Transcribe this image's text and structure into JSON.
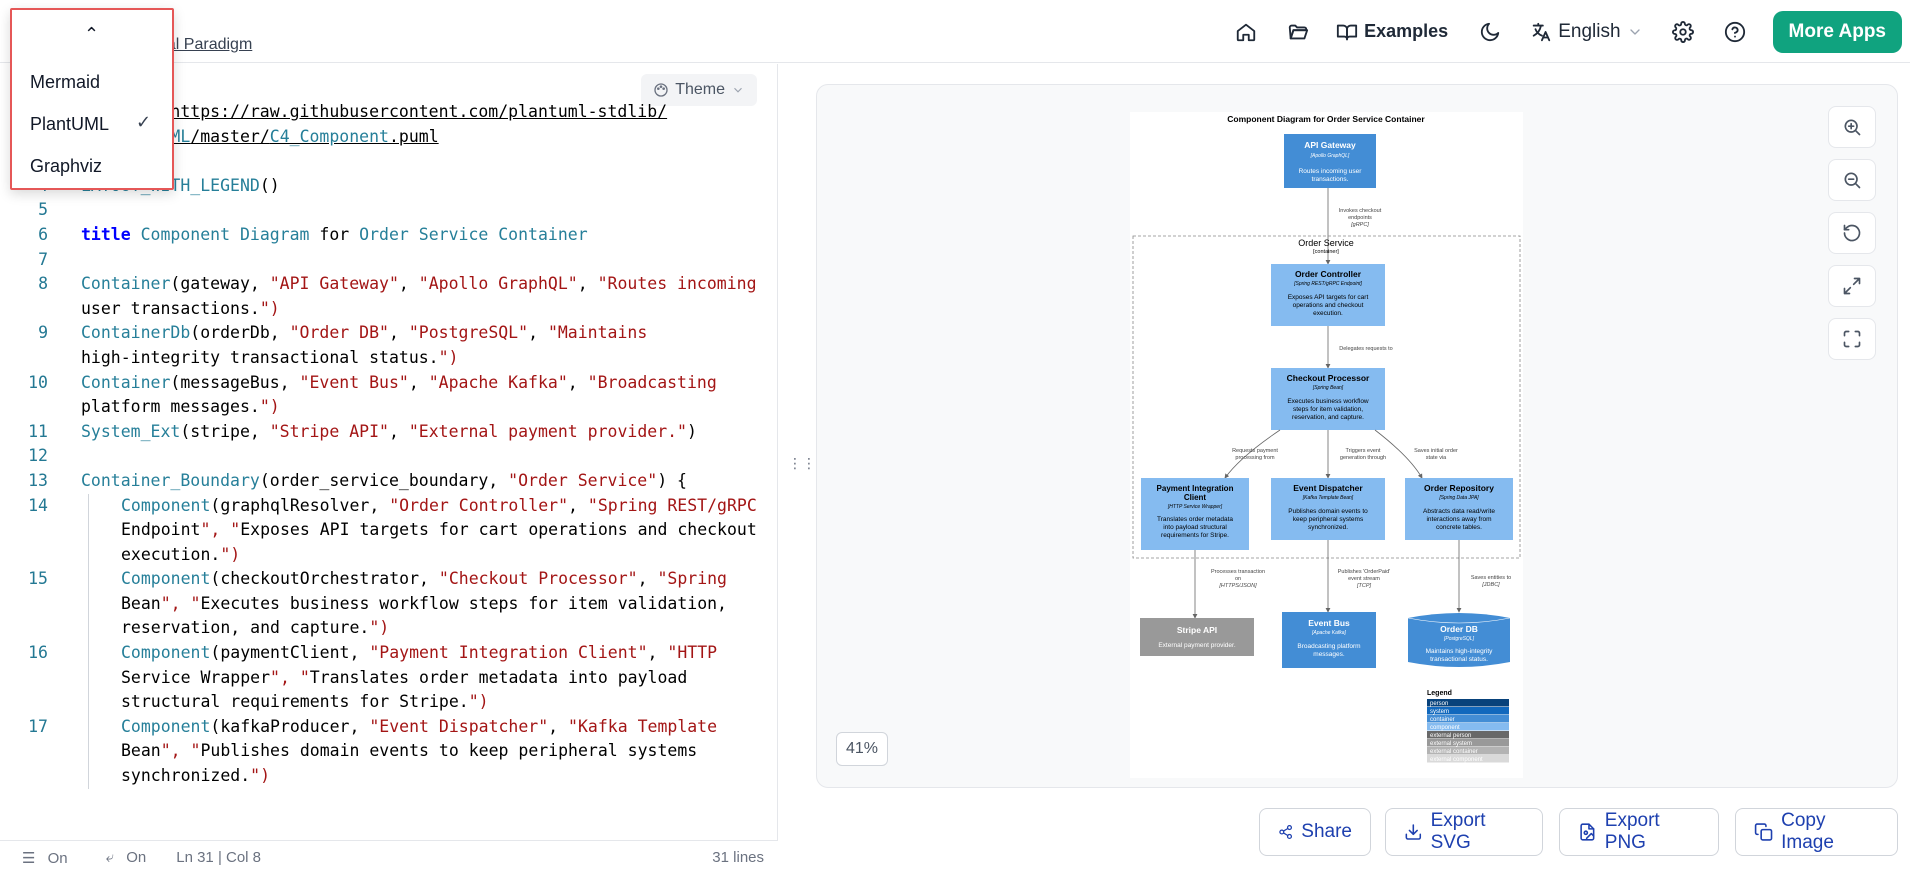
{
  "header": {
    "brand_subtitle": "sual Paradigm",
    "nav": {
      "examples_label": "Examples",
      "language_label": "English",
      "more_apps_label": "More Apps"
    }
  },
  "dropdown": {
    "items": [
      {
        "label": "Mermaid",
        "checked": false
      },
      {
        "label": "PlantUML",
        "checked": true
      },
      {
        "label": "Graphviz",
        "checked": false
      }
    ]
  },
  "editor": {
    "theme_label": "Theme",
    "status": {
      "line_numbers": "On",
      "word_wrap": "On",
      "cursor": "Ln 31 | Col 8",
      "line_count": "31 lines"
    },
    "code_lines": [
      {
        "n": "",
        "text": "!include https://raw.githubusercontent.com/plantuml-stdlib/"
      },
      {
        "n": "",
        "text": "C4-PlantUML/master/C4_Component.puml"
      },
      {
        "n": "3",
        "text": ""
      },
      {
        "n": "4",
        "text": "LAYOUT_WITH_LEGEND()"
      },
      {
        "n": "5",
        "text": ""
      },
      {
        "n": "6",
        "text": "title Component Diagram for Order Service Container"
      },
      {
        "n": "7",
        "text": ""
      },
      {
        "n": "8",
        "text": "Container(gateway, \"API Gateway\", \"Apollo GraphQL\", \"Routes incoming"
      },
      {
        "n": "",
        "text": "user transactions.\")"
      },
      {
        "n": "9",
        "text": "ContainerDb(orderDb, \"Order DB\", \"PostgreSQL\", \"Maintains"
      },
      {
        "n": "",
        "text": "high-integrity transactional status.\")"
      },
      {
        "n": "10",
        "text": "Container(messageBus, \"Event Bus\", \"Apache Kafka\", \"Broadcasting"
      },
      {
        "n": "",
        "text": "platform messages.\")"
      },
      {
        "n": "11",
        "text": "System_Ext(stripe, \"Stripe API\", \"External payment provider.\")"
      },
      {
        "n": "12",
        "text": ""
      },
      {
        "n": "13",
        "text": "Container_Boundary(order_service_boundary, \"Order Service\") {"
      },
      {
        "n": "14",
        "text": "Component(graphqlResolver, \"Order Controller\", \"Spring REST/gRPC"
      },
      {
        "n": "",
        "text": "Endpoint\", \"Exposes API targets for cart operations and checkout"
      },
      {
        "n": "",
        "text": "execution.\")"
      },
      {
        "n": "15",
        "text": "Component(checkoutOrchestrator, \"Checkout Processor\", \"Spring"
      },
      {
        "n": "",
        "text": "Bean\", \"Executes business workflow steps for item validation,"
      },
      {
        "n": "",
        "text": "reservation, and capture.\")"
      },
      {
        "n": "16",
        "text": "Component(paymentClient, \"Payment Integration Client\", \"HTTP"
      },
      {
        "n": "",
        "text": "Service Wrapper\", \"Translates order metadata into payload"
      },
      {
        "n": "",
        "text": "structural requirements for Stripe.\")"
      },
      {
        "n": "17",
        "text": "Component(kafkaProducer, \"Event Dispatcher\", \"Kafka Template"
      },
      {
        "n": "",
        "text": "Bean\", \"Publishes domain events to keep peripheral systems"
      },
      {
        "n": "",
        "text": "synchronized.\")"
      }
    ]
  },
  "preview": {
    "zoom_label": "41%",
    "actions": {
      "share": "Share",
      "export_svg": "Export SVG",
      "export_png": "Export PNG",
      "copy_image": "Copy Image"
    },
    "diagram": {
      "title": "Component Diagram for Order Service Container",
      "gateway": {
        "name": "API Gateway",
        "tech": "[Apollo GraphQL]",
        "desc": "Routes incoming user transactions."
      },
      "boundary_label": "Order Service",
      "boundary_type": "[container]",
      "controller": {
        "name": "Order Controller",
        "tech": "[Spring REST/gRPC Endpoint]",
        "desc": "Exposes API targets for cart operations and checkout execution."
      },
      "processor": {
        "name": "Checkout Processor",
        "tech": "[Spring Bean]",
        "desc": "Executes business workflow steps for item validation, reservation, and capture."
      },
      "payment": {
        "name": "Payment Integration Client",
        "tech": "[HTTP Service Wrapper]",
        "desc": "Translates order metadata into payload structural requirements for Stripe."
      },
      "dispatcher": {
        "name": "Event Dispatcher",
        "tech": "[Kafka Template Bean]",
        "desc": "Publishes domain events to keep peripheral systems synchronized."
      },
      "repository": {
        "name": "Order Repository",
        "tech": "[Spring Data JPA]",
        "desc": "Abstracts data read/write interactions away from concrete tables."
      },
      "stripe": {
        "name": "Stripe API",
        "desc": "External payment provider."
      },
      "bus": {
        "name": "Event Bus",
        "tech": "[Apache Kafka]",
        "desc": "Broadcasting platform messages."
      },
      "db": {
        "name": "Order DB",
        "tech": "[PostgreSQL]",
        "desc": "Maintains high-integrity transactional status."
      },
      "rel_gateway": "Invokes checkout endpoints [gRPC]",
      "rel_controller": "Delegates requests to",
      "rel_payment": "Requests payment processing from",
      "rel_dispatch": "Triggers event generation through",
      "rel_repo": "Saves initial order state via",
      "rel_stripe": "Processes transaction on [HTTPS/JSON]",
      "rel_bus": "Publishes 'OrderPaid' event stream [TCP]",
      "rel_db": "Saves entities to [JDBC]",
      "legend_title": "Legend",
      "legend_items": [
        "person",
        "system",
        "container",
        "component",
        "external person",
        "external system",
        "external container",
        "external component"
      ]
    }
  }
}
